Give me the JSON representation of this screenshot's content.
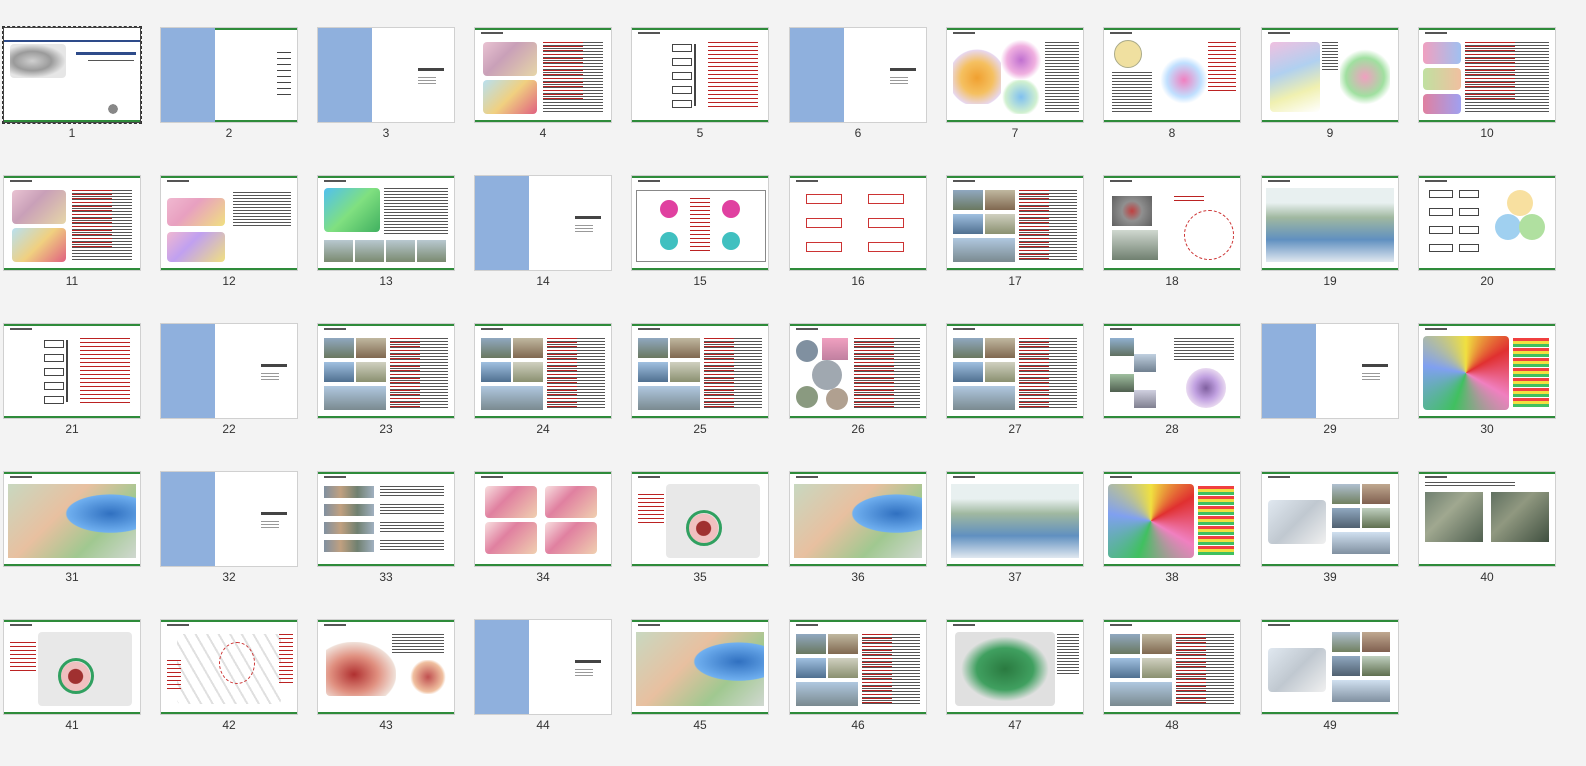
{
  "slides": [
    {
      "n": "1",
      "kind": "cover"
    },
    {
      "n": "2",
      "kind": "toc"
    },
    {
      "n": "3",
      "kind": "section"
    },
    {
      "n": "4",
      "kind": "map-text"
    },
    {
      "n": "5",
      "kind": "flow"
    },
    {
      "n": "6",
      "kind": "section"
    },
    {
      "n": "7",
      "kind": "regional-map"
    },
    {
      "n": "8",
      "kind": "circles-map"
    },
    {
      "n": "9",
      "kind": "two-maps"
    },
    {
      "n": "10",
      "kind": "maps-text"
    },
    {
      "n": "11",
      "kind": "map-text"
    },
    {
      "n": "12",
      "kind": "two-plans"
    },
    {
      "n": "13",
      "kind": "site-photos"
    },
    {
      "n": "14",
      "kind": "section"
    },
    {
      "n": "15",
      "kind": "bubble-diagram"
    },
    {
      "n": "16",
      "kind": "boxes"
    },
    {
      "n": "17",
      "kind": "photos-text"
    },
    {
      "n": "18",
      "kind": "diagram"
    },
    {
      "n": "19",
      "kind": "aerial-render"
    },
    {
      "n": "20",
      "kind": "flow-circles"
    },
    {
      "n": "21",
      "kind": "flow"
    },
    {
      "n": "22",
      "kind": "section"
    },
    {
      "n": "23",
      "kind": "photos-text"
    },
    {
      "n": "24",
      "kind": "photos-text"
    },
    {
      "n": "25",
      "kind": "photos-text"
    },
    {
      "n": "26",
      "kind": "circles-text"
    },
    {
      "n": "27",
      "kind": "photos-text"
    },
    {
      "n": "28",
      "kind": "photos-diagram"
    },
    {
      "n": "29",
      "kind": "section"
    },
    {
      "n": "30",
      "kind": "landuse-map"
    },
    {
      "n": "31",
      "kind": "masterplan"
    },
    {
      "n": "32",
      "kind": "section"
    },
    {
      "n": "33",
      "kind": "strips"
    },
    {
      "n": "34",
      "kind": "plan-grid"
    },
    {
      "n": "35",
      "kind": "plan-diagram"
    },
    {
      "n": "36",
      "kind": "masterplan"
    },
    {
      "n": "37",
      "kind": "aerial-render"
    },
    {
      "n": "38",
      "kind": "landuse-map"
    },
    {
      "n": "39",
      "kind": "plan-photos"
    },
    {
      "n": "40",
      "kind": "satellite"
    },
    {
      "n": "41",
      "kind": "plan-diagram"
    },
    {
      "n": "42",
      "kind": "plan-lines"
    },
    {
      "n": "43",
      "kind": "3d-model"
    },
    {
      "n": "44",
      "kind": "section"
    },
    {
      "n": "45",
      "kind": "masterplan"
    },
    {
      "n": "46",
      "kind": "photos-text"
    },
    {
      "n": "47",
      "kind": "park-plan"
    },
    {
      "n": "48",
      "kind": "photos-text"
    },
    {
      "n": "49",
      "kind": "plan-photos"
    }
  ],
  "selected": "1",
  "colors": {
    "accent": "#2e8b3a",
    "section_blue": "#8fb0dd",
    "background": "#f3f3f3"
  }
}
